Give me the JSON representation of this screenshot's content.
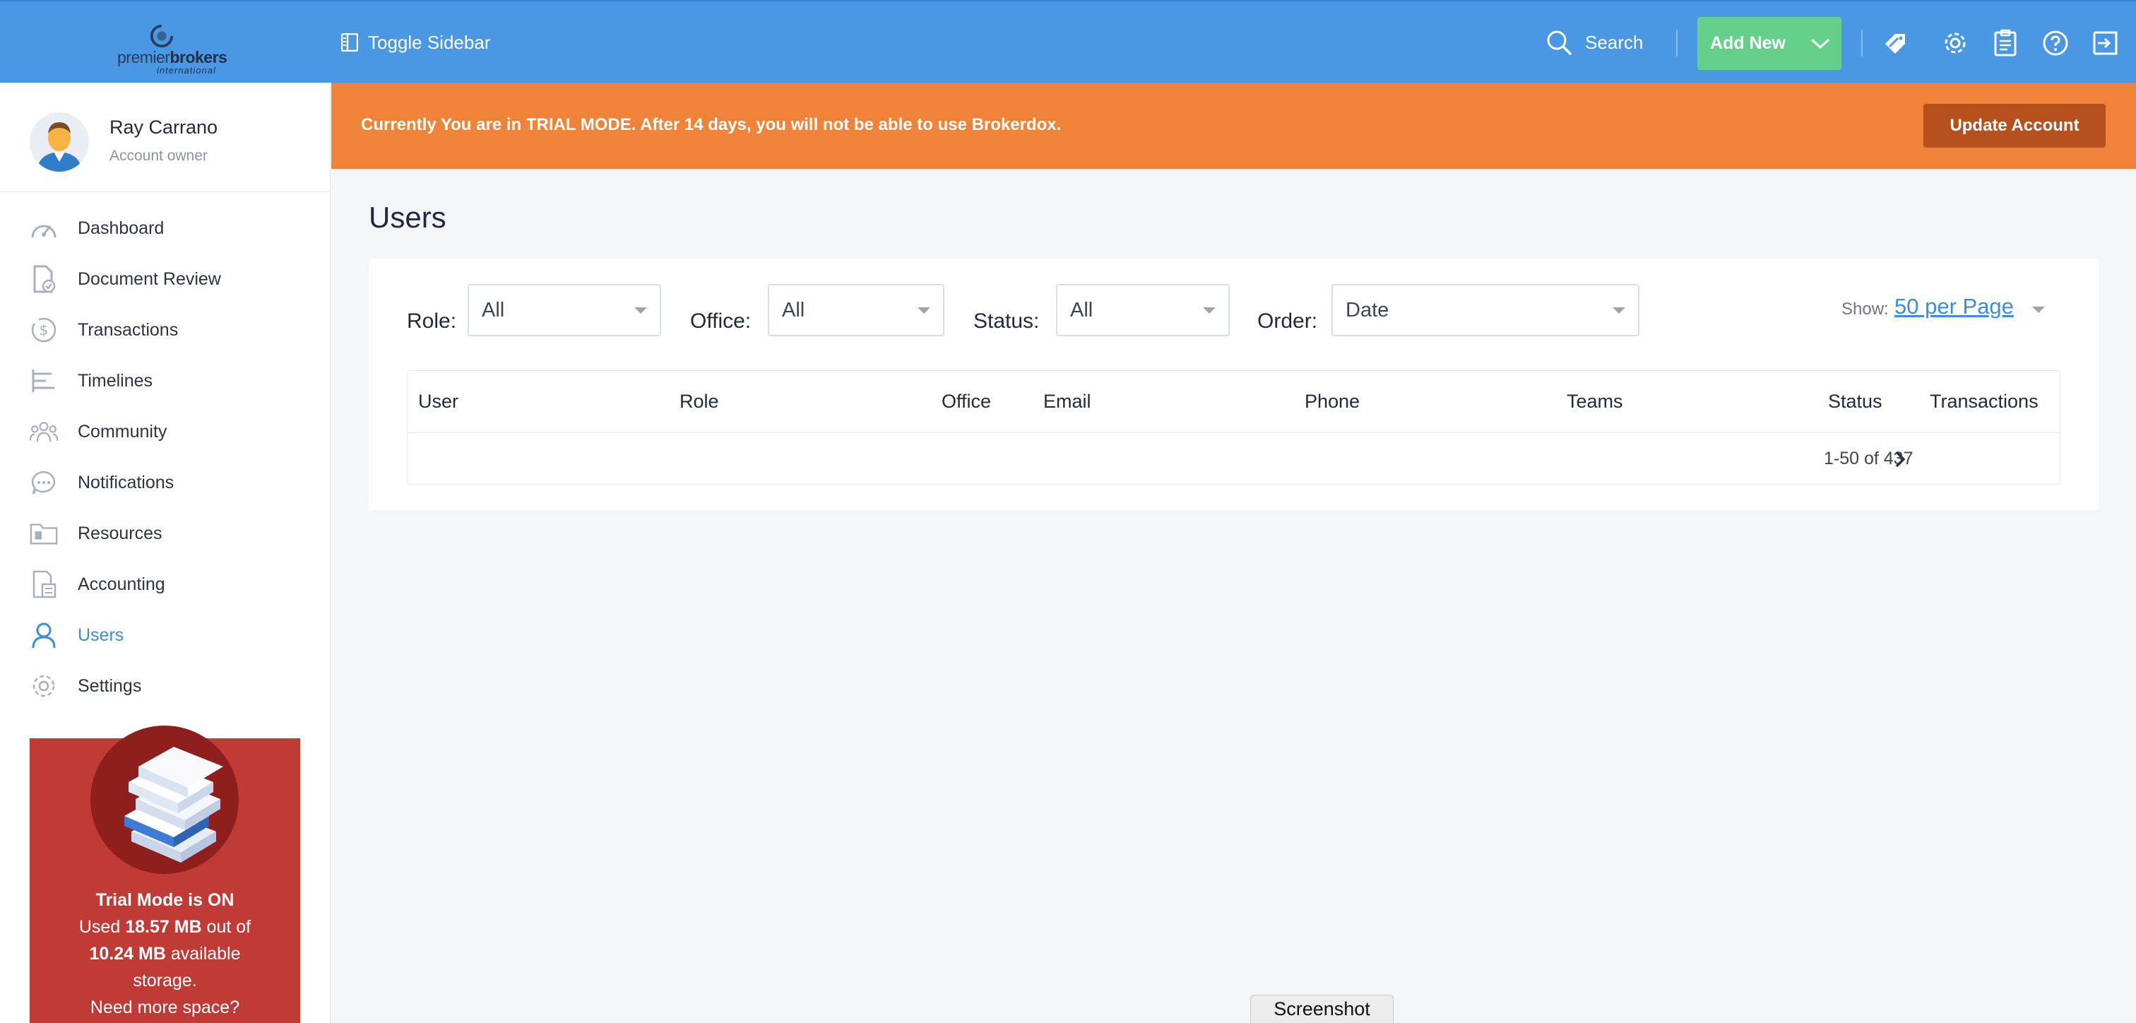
{
  "app": {
    "logo": {
      "text_light": "premier",
      "text_bold": "brokers",
      "sub": "international"
    }
  },
  "topbar": {
    "toggle_sidebar_label": "Toggle Sidebar",
    "search_label": "Search",
    "add_new_label": "Add New",
    "icons": [
      "tag-icon",
      "gear-icon",
      "clipboard-icon",
      "help-icon",
      "logout-icon"
    ]
  },
  "profile": {
    "name": "Ray Carrano",
    "role": "Account owner"
  },
  "sidebar": {
    "items": [
      {
        "label": "Dashboard",
        "icon": "dashboard-icon",
        "active": false
      },
      {
        "label": "Document Review",
        "icon": "document-review-icon",
        "active": false
      },
      {
        "label": "Transactions",
        "icon": "dollar-icon",
        "active": false
      },
      {
        "label": "Timelines",
        "icon": "timeline-icon",
        "active": false
      },
      {
        "label": "Community",
        "icon": "community-icon",
        "active": false
      },
      {
        "label": "Notifications",
        "icon": "chat-bubble-icon",
        "active": false
      },
      {
        "label": "Resources",
        "icon": "folder-icon",
        "active": false
      },
      {
        "label": "Accounting",
        "icon": "calculator-icon",
        "active": false
      },
      {
        "label": "Users",
        "icon": "user-icon",
        "active": true
      },
      {
        "label": "Settings",
        "icon": "gear-icon",
        "active": false
      }
    ]
  },
  "trial_card": {
    "title": "Trial Mode is ON",
    "used_prefix": "Used",
    "used_value": "18.57 MB",
    "used_mid": "out of",
    "total_value": "10.24 MB",
    "total_suffix": "available",
    "storage": "storage.",
    "cta": "Need more space?"
  },
  "banner": {
    "message": "Currently You are in TRIAL MODE. After 14 days, you will not be able to use Brokerdox.",
    "button_label": "Update Account"
  },
  "main": {
    "title": "Users",
    "filters": {
      "role_label": "Role:",
      "role_value": "All",
      "office_label": "Office:",
      "office_value": "All",
      "status_label": "Status:",
      "status_value": "All",
      "order_label": "Order:",
      "order_value": "Date",
      "show_label": "Show:",
      "show_value": "50 per Page"
    },
    "table": {
      "columns": [
        "User",
        "Role",
        "Office",
        "Email",
        "Phone",
        "Teams",
        "Status",
        "Transactions"
      ],
      "pagination": "1-50 of 437"
    }
  },
  "screenshot_tab": "Screenshot",
  "colors": {
    "topbar": "#4a98e3",
    "add_new": "#64d08a",
    "banner": "#ef8339",
    "update_button": "#b6501d",
    "trial_card": "#c03a36",
    "active_nav": "#3a8de0"
  }
}
